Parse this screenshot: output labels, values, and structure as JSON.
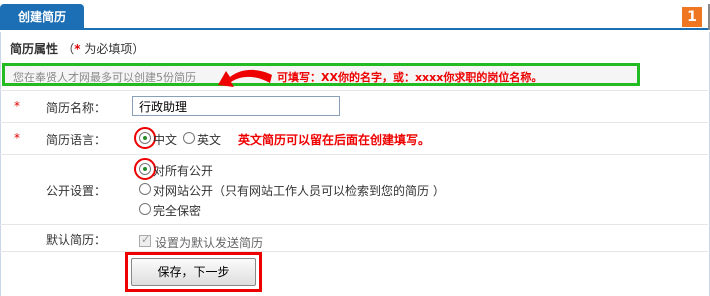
{
  "header": {
    "tab_label": "创建简历",
    "step_number": "1"
  },
  "section": {
    "title": "简历属性",
    "required_note_open": "（",
    "required_star": "*",
    "required_note": " 为必填项）"
  },
  "hint": {
    "text": "您在奉贤人才网最多可以创建5份简历",
    "annotation": "可填写：XX你的名字，或：xxxx你求职的岗位名称。"
  },
  "fields": {
    "name": {
      "label": "简历名称：",
      "value": "行政助理"
    },
    "language": {
      "label": "简历语言：",
      "options": [
        "中文",
        "英文"
      ],
      "selected": "中文",
      "annotation": "英文简历可以留在后面在创建填写。"
    },
    "visibility": {
      "label": "公开设置：",
      "options": [
        "对所有公开",
        "对网站公开（只有网站工作人员可以检索到您的简历 ）",
        "完全保密"
      ],
      "selected": "对所有公开"
    },
    "default": {
      "label": "默认简历：",
      "checkbox_label": "设置为默认发送简历",
      "checked": true
    }
  },
  "actions": {
    "save_label": "保存，下一步"
  },
  "colors": {
    "tab_blue": "#1d6fb5",
    "annotation_red": "#e00000",
    "hint_green": "#22bb22",
    "badge_orange": "#f07722"
  }
}
